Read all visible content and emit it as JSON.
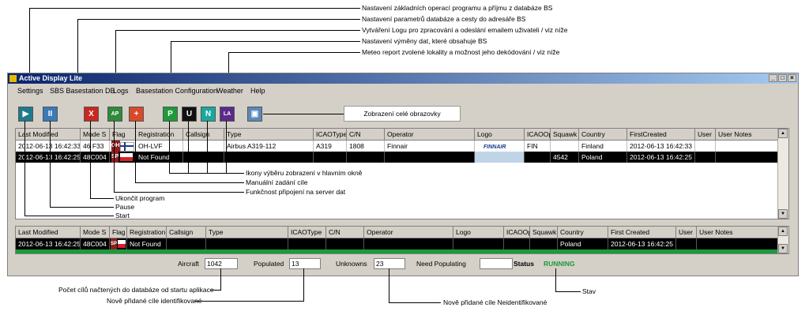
{
  "top_annotations": [
    "Nastavení základních operací programu a příjmu z databáze BS",
    "Nastavení parametrů databáze a cesty do adresáře BS",
    "Vytváření Logu pro zpracování a odeslání emailem uživateli / viz níže",
    "Nastavení výměny dat, které obsahuje BS",
    "Meteo report zvolené lokality a možnost jeho dekódování / viz níže"
  ],
  "window": {
    "title": "Active Display Lite"
  },
  "menu": [
    "Settings",
    "SBS Basestation DB",
    "Logs",
    "Basestation Configuration",
    "Weather",
    "Help"
  ],
  "toolbar": [
    {
      "glyph": "▶",
      "color": "#1e7a8c"
    },
    {
      "glyph": "II",
      "color": "#3a7ab8"
    },
    {
      "glyph": "X",
      "color": "#c8281e"
    },
    {
      "glyph": "AP",
      "color": "#2f8a3a"
    },
    {
      "glyph": "+",
      "color": "#d84a2a"
    },
    {
      "glyph": "P",
      "color": "#1f9a3a"
    },
    {
      "glyph": "U",
      "color": "#111111"
    },
    {
      "glyph": "N",
      "color": "#1aa7a0"
    },
    {
      "glyph": "LA",
      "color": "#5b2a8a"
    },
    {
      "glyph": "▣",
      "color": "#5a8ab8"
    }
  ],
  "fullscreen_callout": "Zobrazení celé obrazovky",
  "grid_top": {
    "headers": [
      "Last Modified",
      "Mode S",
      "Flag",
      "Registration",
      "Callsign",
      "Type",
      "ICAOType",
      "C/N",
      "Operator",
      "Logo",
      "ICAOOp",
      "Squawk",
      "Country",
      "FirstCreated",
      "User",
      "User Notes"
    ],
    "rows": [
      {
        "cells": [
          "2012-06-13 16:42:33",
          "46 F33",
          "OH",
          "OH-LVF",
          "",
          "Airbus A319-112",
          "A319",
          "1808",
          "Finnair",
          "FINNAIR",
          "FIN",
          "",
          "Finland",
          "2012-06-13 16:42:33",
          "",
          ""
        ]
      },
      {
        "cells": [
          "2012-06-13 16:42:25",
          "48C004",
          "SP",
          "Not Found",
          "",
          "",
          "",
          "",
          "",
          "",
          "",
          "4542",
          "Poland",
          "2012-06-13 16:42:25",
          "",
          ""
        ]
      }
    ]
  },
  "grid_bottom": {
    "headers": [
      "Last Modified",
      "Mode S",
      "Flag",
      "Registration",
      "Callsign",
      "Type",
      "ICAOType",
      "C/N",
      "Operator",
      "Logo",
      "ICAOOp",
      "Squawk",
      "Country",
      "First Created",
      "User",
      "User Notes"
    ],
    "rows": [
      {
        "cells": [
          "2012-06-13 16:42:25",
          "48C004",
          "SP",
          "Not Found",
          "",
          "",
          "",
          "",
          "",
          "",
          "",
          "",
          "Poland",
          "2012-06-13 16:42:25",
          "",
          ""
        ]
      }
    ]
  },
  "status_bar": {
    "aircraft_label": "Aircraft",
    "aircraft_value": "1042",
    "populated_label": "Populated",
    "populated_value": "13",
    "unknowns_label": "Unknowns",
    "unknowns_value": "23",
    "need_label": "Need Populating",
    "need_value": "",
    "status_label": "Status",
    "status_value": "RUNNING",
    "status_color": "#1a9a3a"
  },
  "mid_annotations": {
    "ikony": "Ikony výběru zobrazení v hlavním okně",
    "manualni": "Manuální zadání cíle",
    "funkcnost": "Funkčnost připojení na server dat",
    "ukoncit": "Ukončit program",
    "pause": "Pause",
    "start": "Start"
  },
  "bottom_annotations": {
    "pocet": "Počet cílů načtených do databáze od startu aplikace",
    "nove_id": "Nově přidané cíle identifikované",
    "nove_neid": "Nově přidané cíle Neidentifikované",
    "stav": "Stav"
  }
}
